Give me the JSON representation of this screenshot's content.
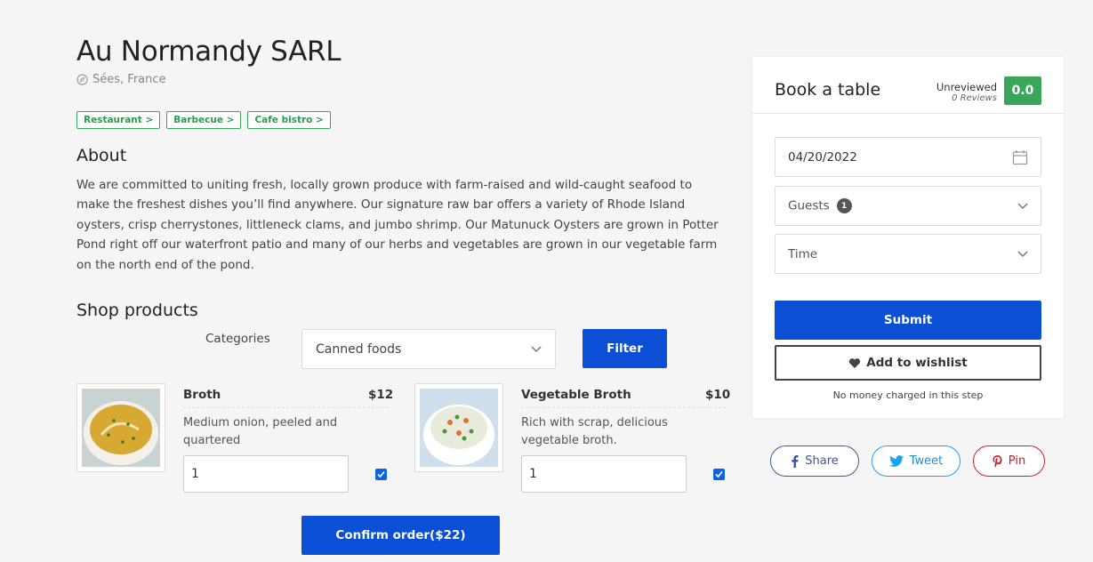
{
  "restaurant": {
    "name": "Au Normandy SARL",
    "location": "Sées, France",
    "tags": [
      "Restaurant >",
      "Barbecue >",
      "Cafe bistro >"
    ]
  },
  "about": {
    "heading": "About",
    "text": "We are committed to uniting fresh, locally grown produce with farm-raised and wild-caught seafood to make the freshest dishes you’ll find anywhere. Our signature raw bar offers a variety of Rhode Island oysters, crisp cherrystones, littleneck clams, and jumbo shrimp. Our Matunuck Oysters are grown in Potter Pond right off our waterfront patio and many of our herbs and vegetables are grown in our vegetable farm on the north end of the pond."
  },
  "shop": {
    "heading": "Shop products",
    "categories_label": "Categories",
    "selected_category": "Canned foods",
    "filter_label": "Filter",
    "products": [
      {
        "name": "Broth",
        "price": "$12",
        "description": "Medium onion, peeled and quartered",
        "quantity": "1",
        "checked": true
      },
      {
        "name": "Vegetable Broth",
        "price": "$10",
        "description": "Rich with scrap, delicious vegetable broth.",
        "quantity": "1",
        "checked": true
      }
    ],
    "confirm_label": "Confirm order($22)"
  },
  "booking": {
    "title": "Book a table",
    "review_status": "Unreviewed",
    "review_count": "0 Reviews",
    "score": "0.0",
    "date_value": "04/20/2022",
    "guests_label": "Guests",
    "guests_count": "1",
    "time_label": "Time",
    "submit_label": "Submit",
    "wishlist_label": "Add to wishlist",
    "note": "No money charged in this step"
  },
  "social": {
    "share_label": "Share",
    "tweet_label": "Tweet",
    "pin_label": "Pin"
  },
  "colors": {
    "primary_blue": "#0b4fd6",
    "green": "#3aa65a",
    "facebook": "#3b5998",
    "twitter": "#1da1f2",
    "pinterest": "#cb2027"
  }
}
